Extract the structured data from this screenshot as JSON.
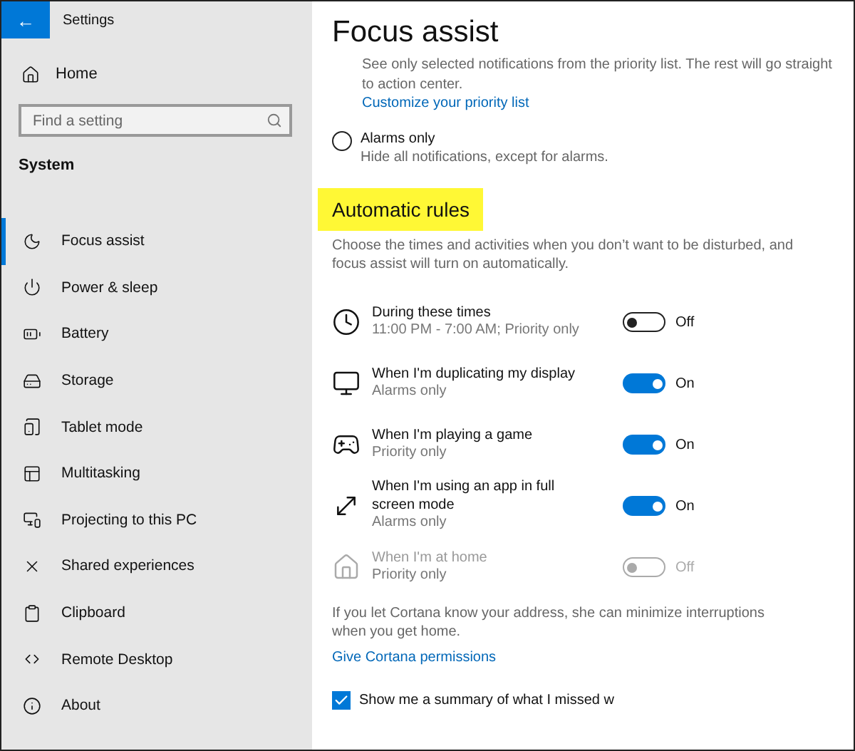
{
  "window": {
    "title": "Settings",
    "back": "←"
  },
  "sidebar": {
    "home": "Home",
    "search": {
      "placeholder": "Find a setting"
    },
    "section": "System",
    "items": [
      {
        "label": "Focus assist",
        "selected": true
      },
      {
        "label": "Power & sleep",
        "selected": false
      },
      {
        "label": "Battery",
        "selected": false
      },
      {
        "label": "Storage",
        "selected": false
      },
      {
        "label": "Tablet mode",
        "selected": false
      },
      {
        "label": "Multitasking",
        "selected": false
      },
      {
        "label": "Projecting to this PC",
        "selected": false
      },
      {
        "label": "Shared experiences",
        "selected": false
      },
      {
        "label": "Clipboard",
        "selected": false
      },
      {
        "label": "Remote Desktop",
        "selected": false
      },
      {
        "label": "About",
        "selected": false
      }
    ]
  },
  "content": {
    "title": "Focus assist",
    "priority_description": "See only selected notifications from the priority list. The rest will go straight to action center.",
    "priority_link": "Customize your priority list",
    "alarms_option": {
      "label": "Alarms only",
      "description": "Hide all notifications, except for alarms.",
      "selected": false
    },
    "rules_heading": "Automatic rules",
    "rules_description": "Choose the times and activities when you don’t want to be disturbed, and focus assist will turn on automatically.",
    "rules": [
      {
        "title": "During these times",
        "detail": "11:00 PM - 7:00 AM; Priority only",
        "on": false,
        "state": "Off",
        "disabled": false
      },
      {
        "title": "When I'm duplicating my display",
        "detail": "Alarms only",
        "on": true,
        "state": "On",
        "disabled": false
      },
      {
        "title": "When I'm playing a game",
        "detail": "Priority only",
        "on": true,
        "state": "On",
        "disabled": false
      },
      {
        "title": "When I'm using an app in full screen mode",
        "detail": "Alarms only",
        "on": true,
        "state": "On",
        "disabled": false
      },
      {
        "title": "When I'm at home",
        "detail": "Priority only",
        "on": false,
        "state": "Off",
        "disabled": true
      }
    ],
    "cortana_text": "If you let Cortana know your address, she can minimize interruptions when you get home.",
    "cortana_link": "Give Cortana permissions",
    "summary": {
      "label": "Show me a summary of what I missed w",
      "checked": true
    }
  }
}
